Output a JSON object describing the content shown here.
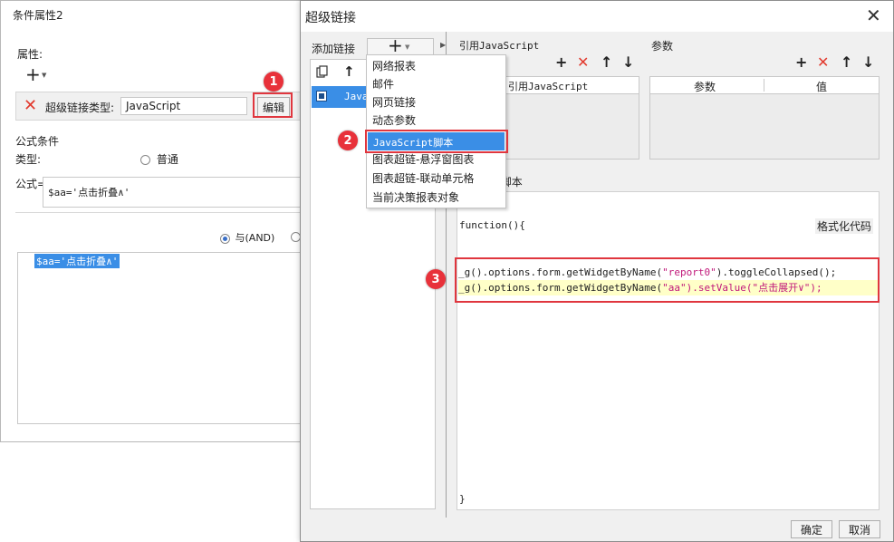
{
  "bg_window": {
    "title": "条件属性2",
    "attr_label": "属性:",
    "hyperlink_type_label": "超级链接类型:",
    "hyperlink_type_value": "JavaScript",
    "edit_button": "编辑",
    "formula_condition_label": "公式条件",
    "type_label": "类型:",
    "type_option_normal": "普通",
    "formula_label": "公式=",
    "formula_value": "$aa='点击折叠∧'",
    "and_option": "与(AND)",
    "condition_item": "$aa='点击折叠∧'"
  },
  "dialog": {
    "title": "超级链接",
    "add_link_label": "添加链接",
    "link_list_item": "Java",
    "ref_js_label": "引用JavaScript",
    "ref_js_column": "引用JavaScript",
    "params_label": "参数",
    "params_columns": [
      "参数",
      "值"
    ],
    "script_label_suffix": "t脚本",
    "format_code": "格式化代码",
    "code_lines": [
      {
        "prefix": "_g().options.form.getWidgetByName(",
        "arg": "\"report0\"",
        "suffix": ").toggleCollapsed();"
      },
      {
        "prefix": "_g().options.form.getWidgetByName(",
        "arg": "\"aa\"",
        "suffix": ").setValue(\"点击展开∨\");"
      }
    ],
    "function_open": "function(){",
    "function_close": "}",
    "ok_button": "确定",
    "cancel_button": "取消"
  },
  "dropdown": {
    "items": [
      "网络报表",
      "邮件",
      "网页链接",
      "动态参数",
      "JavaScript脚本",
      "图表超链-悬浮窗图表",
      "图表超链-联动单元格",
      "当前决策报表对象"
    ],
    "selected_index": 4
  },
  "callouts": [
    "1",
    "2",
    "3"
  ],
  "colors": {
    "accent": "#3c8cde",
    "callout": "#e8313a",
    "delete_red": "#e23a2e",
    "selected_bg": "#3a8ee6",
    "code_string": "#c0187a",
    "highlight_line": "#ffffc8"
  }
}
